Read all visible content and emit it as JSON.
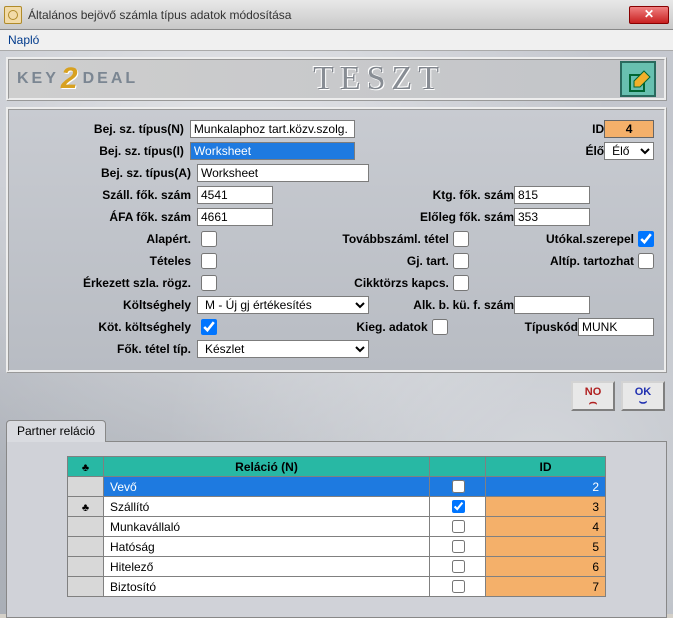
{
  "window": {
    "title": "Általános bejövő számla típus adatok módosítása"
  },
  "menu": {
    "naplo": "Napló"
  },
  "header": {
    "logo_key": "KEY",
    "logo_two": "2",
    "logo_deal": "DEAL",
    "watermark": "TESZT"
  },
  "form": {
    "type_n_label": "Bej. sz. típus(N)",
    "type_n": "Munkalaphoz tart.közv.szolg.",
    "type_i_label": "Bej. sz. típus(I)",
    "type_i": "Worksheet",
    "type_a_label": "Bej. sz. típus(A)",
    "type_a": "Worksheet",
    "szall_label": "Száll. fők. szám",
    "szall": "4541",
    "afa_label": "ÁFA fők. szám",
    "afa": "4661",
    "alap_label": "Alapért.",
    "teteles_label": "Tételes",
    "erk_label": "Érkezett szla. rögz.",
    "ktg_hely_label": "Költséghely",
    "ktg_hely": "M - Új gj értékesítés",
    "kot_label": "Köt. költséghely",
    "fot_label": "Fők. tétel típ.",
    "fot": "Készlet",
    "tovabb_label": "Továbbszáml. tétel",
    "gj_label": "Gj. tart.",
    "cikk_label": "Cikktörzs kapcs.",
    "kieg_label": "Kieg. adatok",
    "id_label": "ID",
    "id": "4",
    "elo_label": "Élő",
    "elo": "Élő",
    "ktg_fsz_label": "Ktg. fők. szám",
    "ktg_fsz": "815",
    "eloleg_label": "Előleg fők. szám",
    "eloleg": "353",
    "utokal_label": "Utókal.szerepel",
    "altip_label": "Altíp. tartozhat",
    "alk_label": "Alk. b. kü. f. szám",
    "alk": "",
    "tipuskod_label": "Típuskód",
    "tipuskod": "MUNK"
  },
  "buttons": {
    "no": "NO",
    "ok": "OK"
  },
  "tab": {
    "title": "Partner reláció",
    "col_sel_glyph": "♣",
    "col_relacio": "Reláció (N)",
    "col_id": "ID",
    "rows": [
      {
        "sel": "",
        "name": "Vevő",
        "chk": false,
        "id": "2",
        "highlight": true
      },
      {
        "sel": "♣",
        "name": "Szállító",
        "chk": true,
        "id": "3"
      },
      {
        "sel": "",
        "name": "Munkavállaló",
        "chk": false,
        "id": "4"
      },
      {
        "sel": "",
        "name": "Hatóság",
        "chk": false,
        "id": "5"
      },
      {
        "sel": "",
        "name": "Hitelező",
        "chk": false,
        "id": "6"
      },
      {
        "sel": "",
        "name": "Biztosító",
        "chk": false,
        "id": "7"
      }
    ]
  }
}
